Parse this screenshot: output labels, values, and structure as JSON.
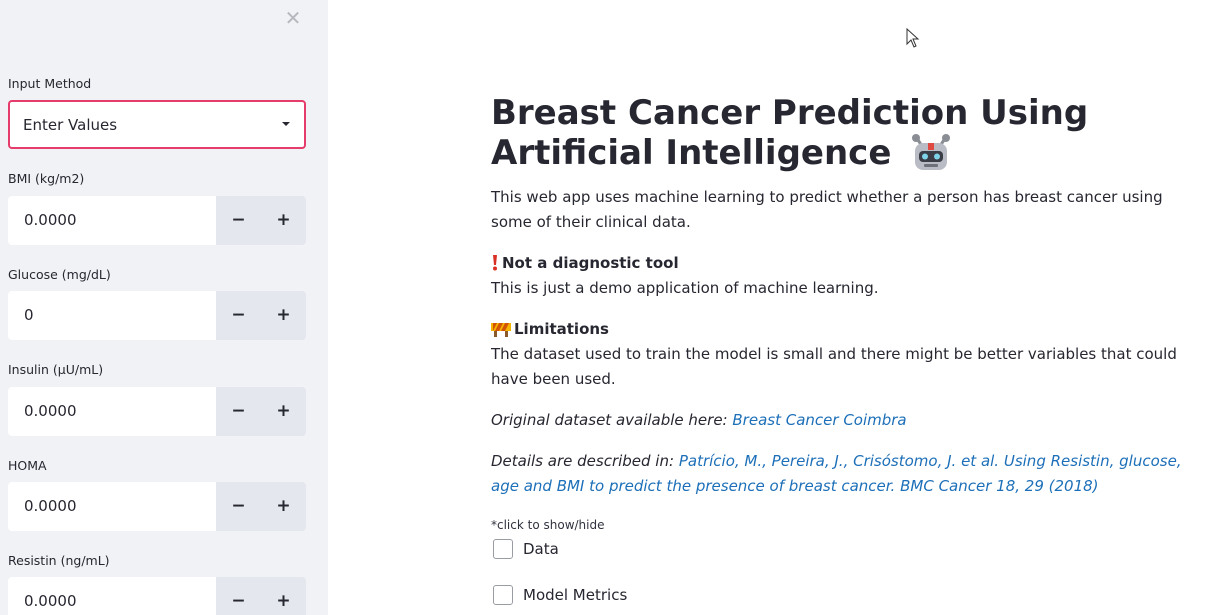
{
  "sidebar": {
    "close_icon": "close-icon",
    "input_method": {
      "label": "Input Method",
      "selected": "Enter Values"
    },
    "fields": [
      {
        "label": "BMI (kg/m2)",
        "value": "0.0000"
      },
      {
        "label": "Glucose (mg/dL)",
        "value": "0"
      },
      {
        "label": "Insulin (µU/mL)",
        "value": "0.0000"
      },
      {
        "label": "HOMA",
        "value": "0.0000"
      },
      {
        "label": "Resistin (ng/mL)",
        "value": "0.0000"
      }
    ],
    "minus_label": "−",
    "plus_label": "+"
  },
  "main": {
    "title": "Breast Cancer Prediction Using Artificial Intelligence",
    "intro": "This web app uses machine learning to predict whether a person has breast cancer using some of their clinical data.",
    "not_diagnostic_heading": "Not a diagnostic tool",
    "not_diagnostic_text": "This is just a demo application of machine learning.",
    "limitations_heading": "Limitations",
    "limitations_text": "The dataset used to train the model is small and there might be better variables that could have been used.",
    "dataset_prefix": "Original dataset available here:",
    "dataset_link": "Breast Cancer Coimbra",
    "details_prefix": "Details are described in:",
    "details_link": "Patrício, M., Pereira, J., Crisóstomo, J. et al. Using Resistin, glucose, age and BMI to predict the presence of breast cancer. BMC Cancer 18, 29 (2018)",
    "hint": "*click to show/hide",
    "checkboxes": [
      {
        "label": "Data",
        "checked": false
      },
      {
        "label": "Model Metrics",
        "checked": false
      }
    ]
  },
  "colors": {
    "accent": "#e63c6b",
    "link": "#1c6fb8",
    "sidebar_bg": "#f0f2f6"
  }
}
